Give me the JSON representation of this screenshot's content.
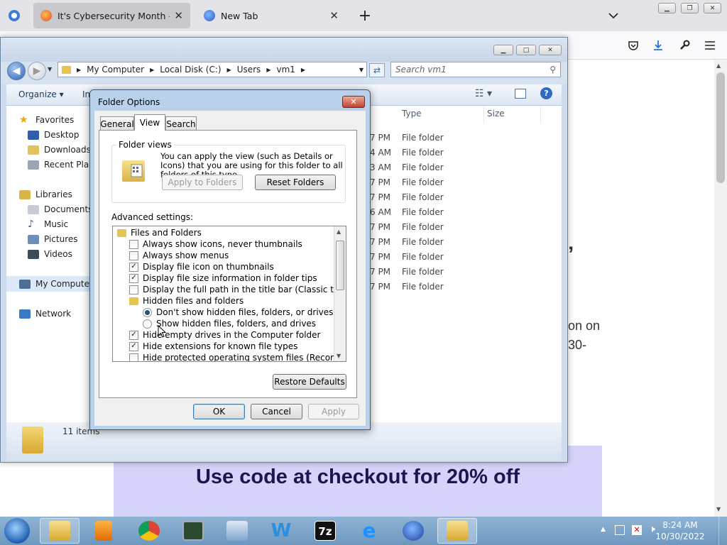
{
  "browser": {
    "tabs": [
      {
        "label": "It's Cybersecurity Month — tim"
      },
      {
        "label": "New Tab"
      }
    ],
    "new_tab_symbol": "+",
    "page": {
      "frag1": "’",
      "frag2": "on on",
      "frag3": "30-",
      "promo": "Use code at checkout for 20% off"
    }
  },
  "explorer": {
    "breadcrumb": [
      "My Computer",
      "Local Disk (C:)",
      "Users",
      "vm1"
    ],
    "search_placeholder": "Search vm1",
    "organize": "Organize",
    "include_partial": "In",
    "columns": {
      "type": "Type",
      "size": "Size"
    },
    "nav": {
      "favorites": "Favorites",
      "desktop": "Desktop",
      "downloads": "Downloads",
      "recent": "Recent Place",
      "libraries": "Libraries",
      "documents": "Documents",
      "music": "Music",
      "pictures": "Pictures",
      "videos": "Videos",
      "computer": "My Computer",
      "network": "Network"
    },
    "rows": [
      {
        "time": "7 PM",
        "type": "File folder"
      },
      {
        "time": "4 AM",
        "type": "File folder"
      },
      {
        "time": "3 AM",
        "type": "File folder"
      },
      {
        "time": "7 PM",
        "type": "File folder"
      },
      {
        "time": "7 PM",
        "type": "File folder"
      },
      {
        "time": "6 AM",
        "type": "File folder"
      },
      {
        "time": "7 PM",
        "type": "File folder"
      },
      {
        "time": "7 PM",
        "type": "File folder"
      },
      {
        "time": "7 PM",
        "type": "File folder"
      },
      {
        "time": "7 PM",
        "type": "File folder"
      },
      {
        "time": "7 PM",
        "type": "File folder"
      }
    ],
    "status": "11 items"
  },
  "dialog": {
    "title": "Folder Options",
    "close": "✕",
    "tabs": {
      "general": "General",
      "view": "View",
      "search": "Search"
    },
    "folder_views_label": "Folder views",
    "folder_views_desc": "You can apply the view (such as Details or Icons) that you are using for this folder to all folders of this type.",
    "apply_to_folders": "Apply to Folders",
    "reset_folders": "Reset Folders",
    "advanced_label": "Advanced settings:",
    "tree": [
      {
        "label": "Files and Folders"
      },
      {
        "label": "Always show icons, never thumbnails",
        "checked": false
      },
      {
        "label": "Always show menus",
        "checked": false
      },
      {
        "label": "Display file icon on thumbnails",
        "checked": true
      },
      {
        "label": "Display file size information in folder tips",
        "checked": true
      },
      {
        "label": "Display the full path in the title bar (Classic theme only)",
        "checked": false
      },
      {
        "label": "Hidden files and folders"
      },
      {
        "label": "Don't show hidden files, folders, or drives",
        "selected": true
      },
      {
        "label": "Show hidden files, folders, and drives",
        "selected": false
      },
      {
        "label": "Hide empty drives in the Computer folder",
        "checked": true
      },
      {
        "label": "Hide extensions for known file types",
        "checked": true
      },
      {
        "label": "Hide protected operating system files (Recommended)",
        "checked": false
      }
    ],
    "restore_defaults": "Restore Defaults",
    "ok": "OK",
    "cancel": "Cancel",
    "apply": "Apply"
  },
  "taskbar": {
    "time": "8:24 AM",
    "date": "10/30/2022"
  },
  "icons": {
    "check": "✓",
    "scroll_up": "▲",
    "scroll_down": "▼"
  }
}
